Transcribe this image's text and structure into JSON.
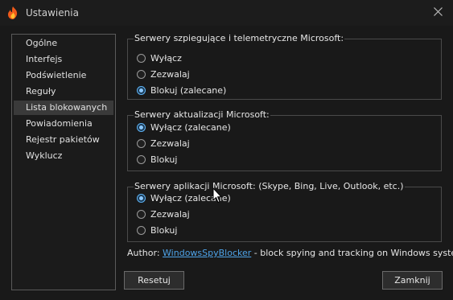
{
  "window": {
    "title": "Ustawienia",
    "app_icon": "flame-icon",
    "close_icon": "close-icon"
  },
  "nav": {
    "items": [
      {
        "label": "Ogólne",
        "selected": false
      },
      {
        "label": "Interfejs",
        "selected": false
      },
      {
        "label": "Podświetlenie",
        "selected": false
      },
      {
        "label": "Reguły",
        "selected": false
      },
      {
        "label": "Lista blokowanych",
        "selected": true
      },
      {
        "label": "Powiadomienia",
        "selected": false
      },
      {
        "label": "Rejestr pakietów",
        "selected": false
      },
      {
        "label": "Wyklucz",
        "selected": false
      }
    ]
  },
  "groups": [
    {
      "title": "Serwery szpiegujące i telemetryczne Microsoft:",
      "options": [
        {
          "label": "Wyłącz",
          "checked": false
        },
        {
          "label": "Zezwalaj",
          "checked": false
        },
        {
          "label": "Blokuj (zalecane)",
          "checked": true
        }
      ]
    },
    {
      "title": "Serwery aktualizacji Microsoft:",
      "options": [
        {
          "label": "Wyłącz (zalecane)",
          "checked": true
        },
        {
          "label": "Zezwalaj",
          "checked": false
        },
        {
          "label": "Blokuj",
          "checked": false
        }
      ]
    },
    {
      "title": "Serwery aplikacji Microsoft: (Skype, Bing, Live, Outlook, etc.)",
      "options": [
        {
          "label": "Wyłącz (zalecane)",
          "checked": true
        },
        {
          "label": "Zezwalaj",
          "checked": false
        },
        {
          "label": "Blokuj",
          "checked": false
        }
      ]
    }
  ],
  "author": {
    "prefix": "Author: ",
    "link_text": "WindowsSpyBlocker",
    "suffix": " - block spying and tracking on Windows systems."
  },
  "buttons": {
    "reset": "Resetuj",
    "close": "Zamknij"
  },
  "colors": {
    "accent": "#5fb3f5",
    "link": "#4ea3e8",
    "background": "#191919"
  }
}
